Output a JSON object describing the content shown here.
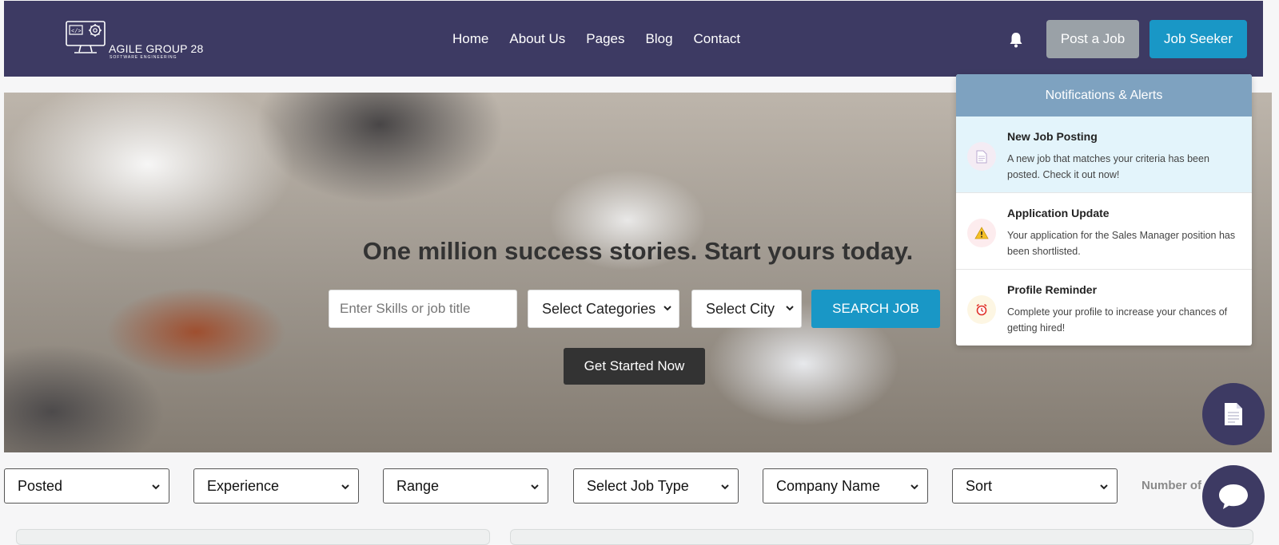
{
  "brand": {
    "title": "AGILE GROUP 28",
    "subtitle": "SOFTWARE ENGINEERING"
  },
  "nav": {
    "links": [
      "Home",
      "About Us",
      "Pages",
      "Blog",
      "Contact"
    ],
    "post_job": "Post a Job",
    "job_seeker": "Job Seeker",
    "bell_icon": "bell-icon"
  },
  "hero": {
    "title": "One million success stories. Start yours today.",
    "search_placeholder": "Enter Skills or job title",
    "categories_selected": "Select Categories",
    "city_selected": "Select City",
    "search_button": "SEARCH JOB",
    "cta_button": "Get Started Now"
  },
  "notifications": {
    "header": "Notifications & Alerts",
    "items": [
      {
        "title": "New Job Posting",
        "text": "A new job that matches your criteria has been posted. Check it out now!",
        "icon": "document-icon",
        "color": "#f4ecf4"
      },
      {
        "title": "Application Update",
        "text": "Your application for the Sales Manager position has been shortlisted.",
        "icon": "warning-icon",
        "color": "#fdecee"
      },
      {
        "title": "Profile Reminder",
        "text": "Complete your profile to increase your chances of getting hired!",
        "icon": "alarm-clock-icon",
        "color": "#fdf6e3"
      }
    ]
  },
  "filters": {
    "items": [
      "Posted",
      "Experience",
      "Range",
      "Select Job Type",
      "Company Name",
      "Sort"
    ],
    "count_label": "Number of Jobs"
  },
  "colors": {
    "navbar": "#3d3a63",
    "accent": "#1997c6",
    "post_button": "#9aa1a7",
    "notif_header": "#7ea2c0"
  }
}
